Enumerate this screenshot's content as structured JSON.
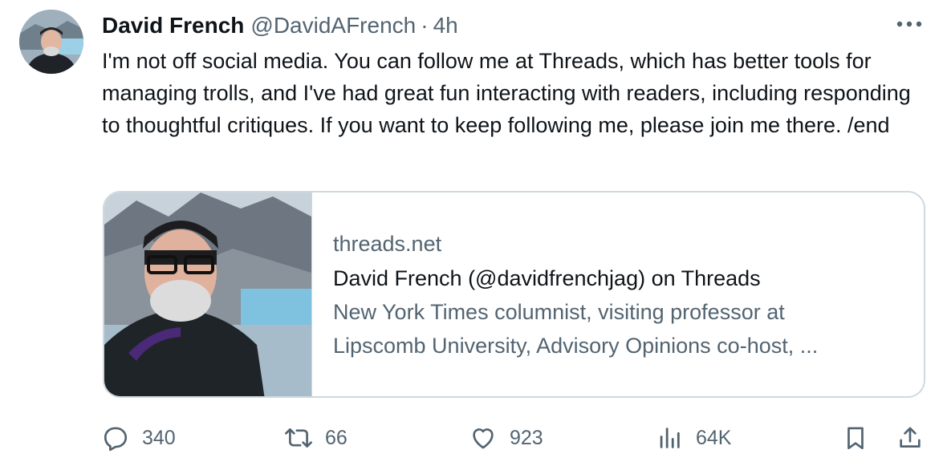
{
  "tweet": {
    "author_name": "David French",
    "author_handle": "@DavidAFrench",
    "separator": "·",
    "time": "4h",
    "text": "I'm not off social media. You can follow me at Threads, which has better tools for managing trolls, and I've had great fun interacting with readers, including responding to thoughtful critiques. If you want to keep following me, please join me there. /end"
  },
  "card": {
    "domain": "threads.net",
    "title": "David French (@davidfrenchjag) on Threads",
    "description_line1": "New York Times columnist, visiting professor at",
    "description_line2": "Lipscomb University, Advisory Opinions co-host, ..."
  },
  "actions": {
    "replies": "340",
    "reposts": "66",
    "likes": "923",
    "views": "64K"
  },
  "icons": {
    "more": "more-icon",
    "reply": "reply-icon",
    "repost": "repost-icon",
    "like": "heart-icon",
    "views": "views-icon",
    "bookmark": "bookmark-icon",
    "share": "share-icon"
  },
  "colors": {
    "text": "#0f1419",
    "secondary": "#536471",
    "border": "#cfd9de"
  }
}
